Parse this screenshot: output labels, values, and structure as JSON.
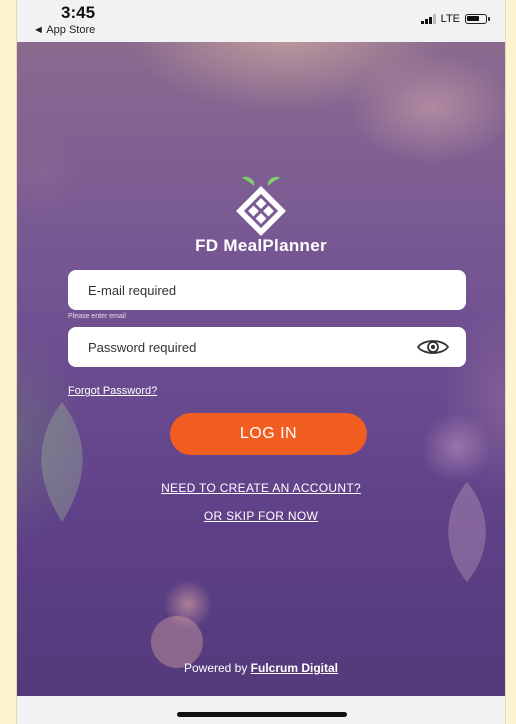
{
  "status_bar": {
    "time": "3:45",
    "back_app": "◄ App Store",
    "network": "LTE"
  },
  "app": {
    "name": "FD MealPlanner",
    "logo_icon": "strawberry-lattice-logo-icon",
    "accent_color": "#f25d21",
    "background_color": "#6c4c90"
  },
  "login_form": {
    "email_placeholder": "E-mail required",
    "email_value": "",
    "email_helper": "Please enter email",
    "password_placeholder": "Password required",
    "password_value": "",
    "password_toggle_icon": "eye-icon",
    "forgot_password": "Forgot Password?",
    "login_button": "LOG IN"
  },
  "links": {
    "create_account": "NEED TO CREATE AN ACCOUNT?",
    "skip": "OR SKIP FOR NOW"
  },
  "footer": {
    "powered_by": "Powered by ",
    "brand": "Fulcrum Digital"
  }
}
